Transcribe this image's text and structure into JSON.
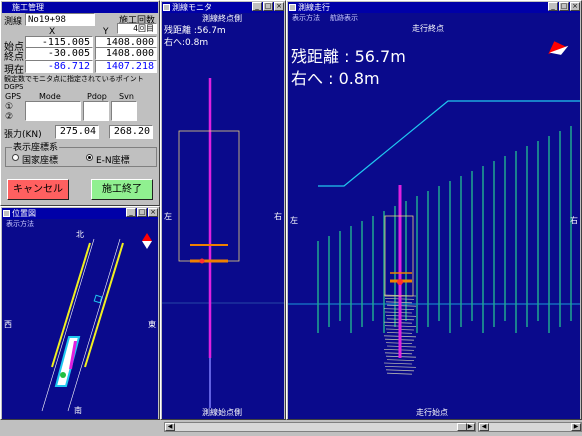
{
  "ctrl": {
    "title": "施工管理",
    "line_label": "測線",
    "line_value": "No19+98",
    "count_label": "施工回数",
    "count_value": "4回目",
    "x_label": "X",
    "y_label": "Y",
    "start_label": "始点",
    "start_x": "-115.005",
    "start_y": "1408.000",
    "end_label": "終点",
    "end_x": "-30.005",
    "end_y": "1408.000",
    "current_label": "現在",
    "current_x": "-86.712",
    "current_y": "1407.218",
    "note": "観定数でモニタ点に指定されているポイント",
    "dgps_label": "DGPS",
    "gps_label": "GPS",
    "mode_label": "Mode",
    "pdop_label": "Pdop",
    "svn_label": "Svn",
    "gps1": "①",
    "gps2": "②",
    "tension_label": "張力(KN)",
    "tension_1": "275.04",
    "tension_2": "268.20",
    "coord_group": "表示座標系",
    "coord_opt1": "国家座標",
    "coord_opt2": "E-N座標",
    "cancel": "キャンセル",
    "finish": "施工終了"
  },
  "overview": {
    "title": "位置図",
    "menu": "表示方法",
    "north": "北",
    "south": "南",
    "west": "西",
    "east": "東"
  },
  "side": {
    "title": "測線モニタ",
    "top": "測線終点側",
    "bottom": "測線始点側",
    "dist": "残距離 :56.7m",
    "offset": "右へ:0.8m",
    "left": "左",
    "right": "右"
  },
  "travel": {
    "title": "測線走行",
    "menu_items": [
      "表示方法",
      "航跡表示"
    ],
    "top": "走行終点",
    "bottom": "走行始点",
    "dist": "残距離  : 56.7m",
    "offset": "右へ : 0.8m",
    "left": "左",
    "right": "右"
  },
  "colors": {
    "navy": "#0a0a8c",
    "titlebar": "#0000a8",
    "cancel": "#ff6060",
    "finish": "#90f090",
    "magenta": "#e020e0",
    "cyan": "#20c8f0",
    "orange": "#f08000"
  }
}
